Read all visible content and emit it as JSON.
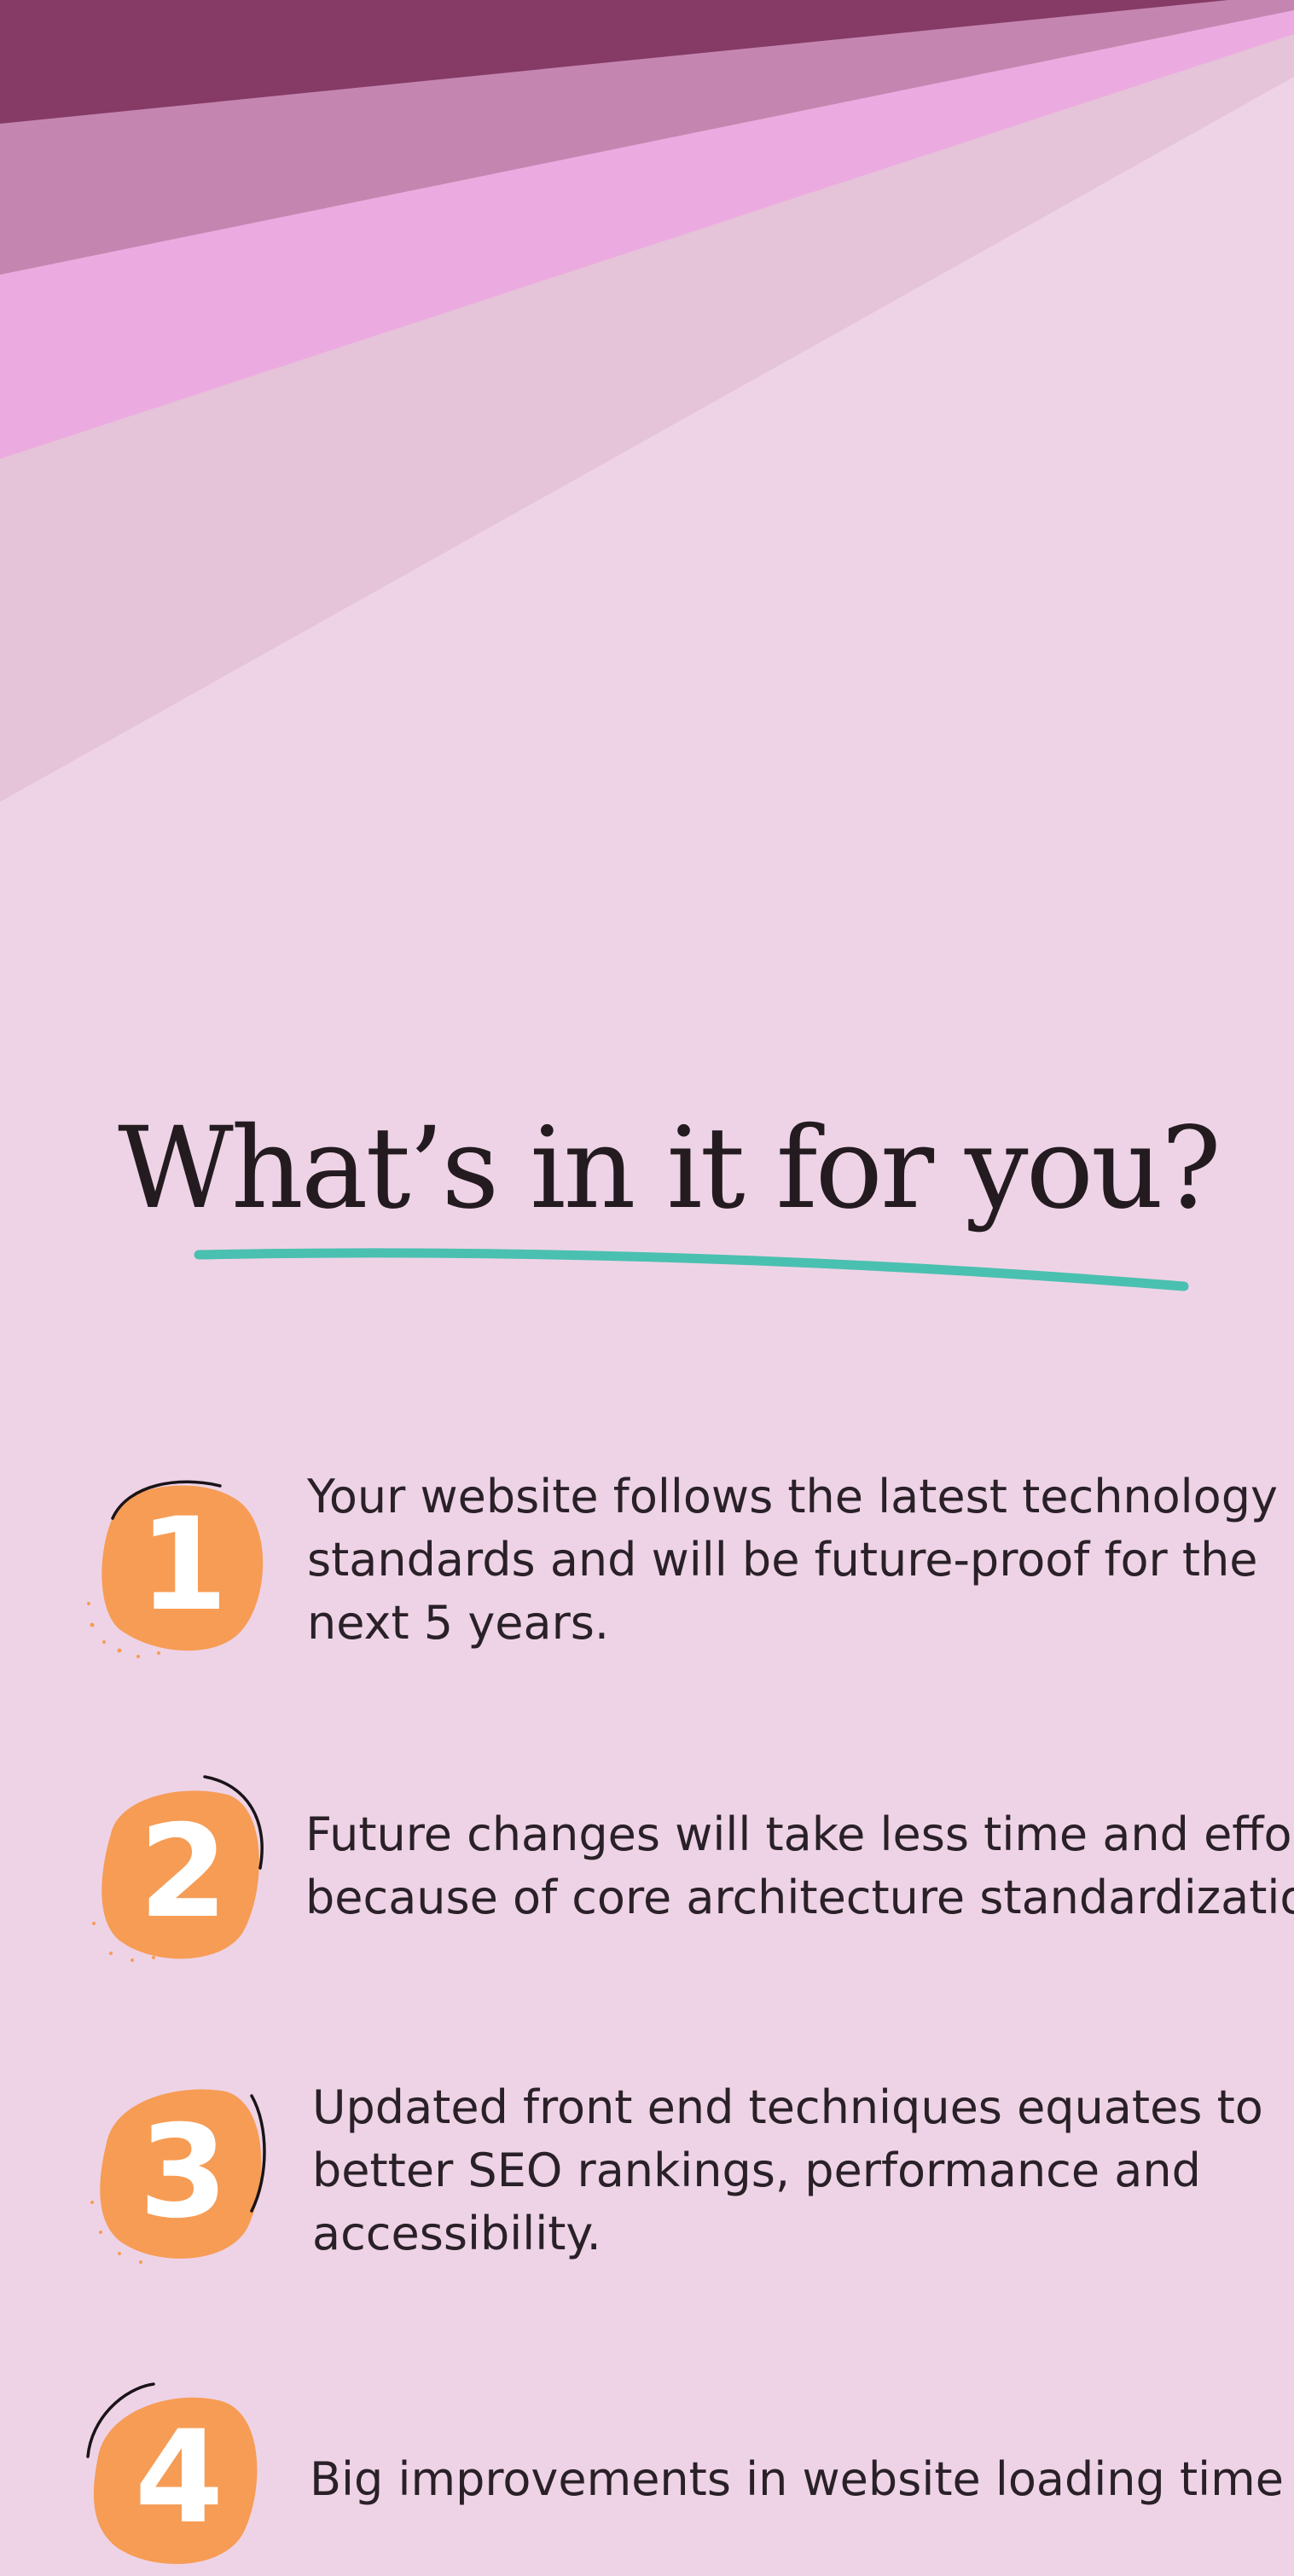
{
  "colors": {
    "background": "#EED3E6",
    "ray_dark": "#863A66",
    "ray_mid": "#C486B0",
    "ray_pink": "#ECABE0",
    "ray_pale": "#E5C3D8",
    "badge": "#F69C55",
    "underline": "#4AC0B0",
    "text": "#2A2128"
  },
  "heading": {
    "title": "What’s in it for you?"
  },
  "items": [
    {
      "number": "1",
      "text": "Your website follows the latest technology\nstandards and will be future-proof for the\nnext 5 years."
    },
    {
      "number": "2",
      "text": "Future changes will take less time and effort\nbecause of core architecture standardization"
    },
    {
      "number": "3",
      "text": "Updated front end techniques equates to\nbetter SEO rankings, performance and\naccessibility."
    },
    {
      "number": "4",
      "text": "Big improvements in website loading time"
    }
  ]
}
